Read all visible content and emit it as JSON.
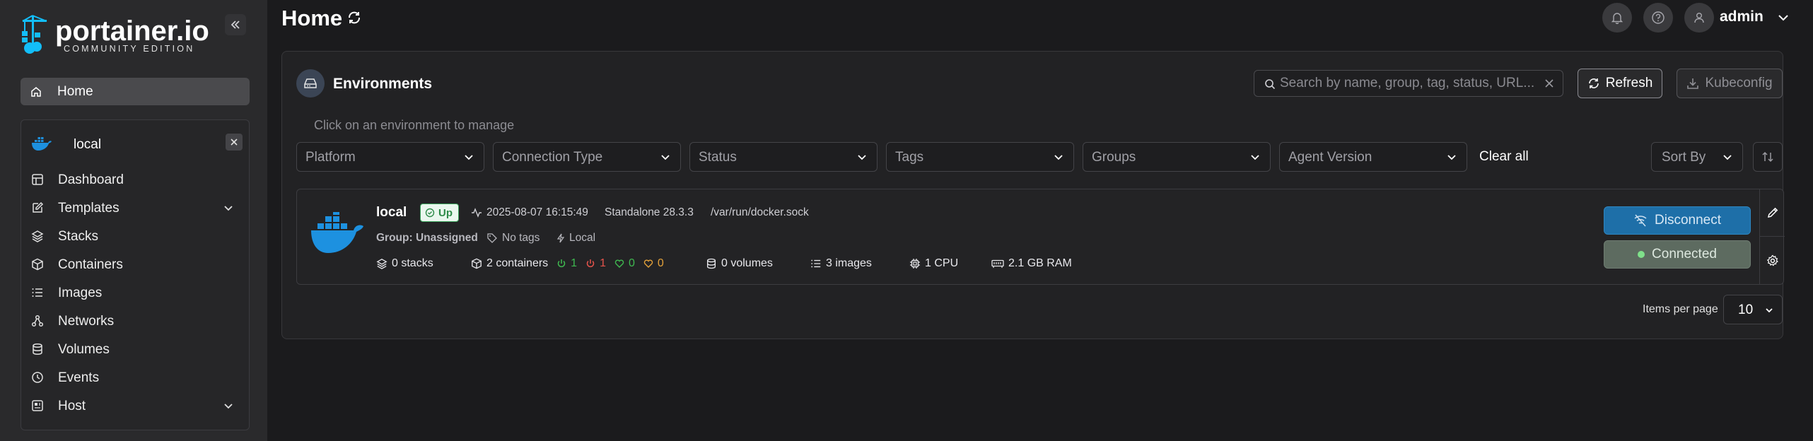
{
  "brand": {
    "name": "portainer.io",
    "edition": "COMMUNITY EDITION"
  },
  "sidebar": {
    "home_label": "Home",
    "environment": {
      "name": "local"
    },
    "items": [
      {
        "label": "Dashboard",
        "icon": "dashboard-icon"
      },
      {
        "label": "Templates",
        "icon": "templates-icon",
        "expandable": true
      },
      {
        "label": "Stacks",
        "icon": "stacks-icon"
      },
      {
        "label": "Containers",
        "icon": "containers-icon"
      },
      {
        "label": "Images",
        "icon": "images-icon"
      },
      {
        "label": "Networks",
        "icon": "networks-icon"
      },
      {
        "label": "Volumes",
        "icon": "volumes-icon"
      },
      {
        "label": "Events",
        "icon": "events-icon"
      },
      {
        "label": "Host",
        "icon": "host-icon",
        "expandable": true
      }
    ]
  },
  "header": {
    "title": "Home",
    "user": "admin"
  },
  "environments": {
    "title": "Environments",
    "hint": "Click on an environment to manage",
    "search_placeholder": "Search by name, group, tag, status, URL...",
    "refresh_label": "Refresh",
    "kubeconfig_label": "Kubeconfig",
    "filters": [
      "Platform",
      "Connection Type",
      "Status",
      "Tags",
      "Groups",
      "Agent Version"
    ],
    "clear_all_label": "Clear all",
    "sort_by_label": "Sort By",
    "items_per_page_label": "Items per page",
    "items_per_page_value": "10"
  },
  "env_card": {
    "name": "local",
    "status": "Up",
    "timestamp": "2025-08-07 16:15:49",
    "type": "Standalone 28.3.3",
    "url": "/var/run/docker.sock",
    "group": "Group: Unassigned",
    "tags": "No tags",
    "connection": "Local",
    "stacks": "0 stacks",
    "containers": "2 containers",
    "running": "1",
    "stopped": "1",
    "healthy": "0",
    "unhealthy": "0",
    "volumes": "0 volumes",
    "images": "3 images",
    "cpu": "1 CPU",
    "ram": "2.1 GB RAM",
    "disconnect_label": "Disconnect",
    "connected_label": "Connected"
  },
  "colors": {
    "background": "#1b1b1d",
    "sidebar": "#2a2a2c",
    "accent_blue": "#1e6fa8",
    "status_green": "#3fb950",
    "status_red": "#e5534b"
  }
}
